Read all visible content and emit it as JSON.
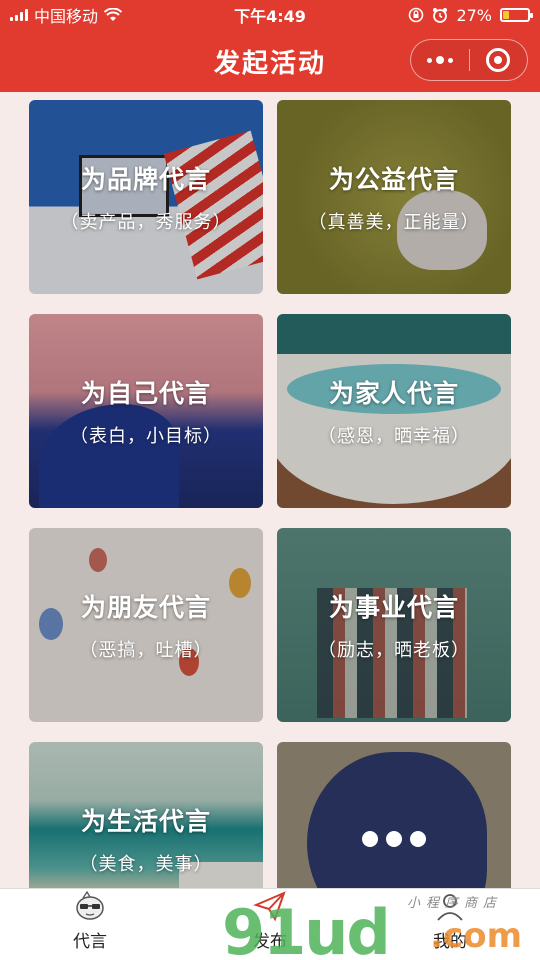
{
  "status_bar": {
    "carrier": "中国移动",
    "time": "下午4:49",
    "battery": "27%",
    "battery_level": 0.27
  },
  "nav": {
    "title": "发起活动"
  },
  "cards": [
    {
      "title": "为品牌代言",
      "subtitle": "（卖产品，秀服务）"
    },
    {
      "title": "为公益代言",
      "subtitle": "（真善美，正能量）"
    },
    {
      "title": "为自己代言",
      "subtitle": "（表白，小目标）"
    },
    {
      "title": "为家人代言",
      "subtitle": "（感恩，晒幸福）"
    },
    {
      "title": "为朋友代言",
      "subtitle": "（恶搞，吐槽）"
    },
    {
      "title": "为事业代言",
      "subtitle": "（励志，晒老板）"
    },
    {
      "title": "为生活代言",
      "subtitle": "（美食，美事）"
    }
  ],
  "tabs": [
    {
      "label": "代言",
      "icon": "mascot-icon"
    },
    {
      "label": "发布",
      "icon": "send-icon"
    },
    {
      "label": "我的",
      "icon": "profile-icon"
    }
  ],
  "watermark": {
    "main": "91ud",
    "suffix": ".com",
    "tagline": "小程序商店"
  },
  "colors": {
    "primary": "#e13a2f",
    "page_bg": "#f6ebe8",
    "tab_bg": "#ffffff"
  }
}
